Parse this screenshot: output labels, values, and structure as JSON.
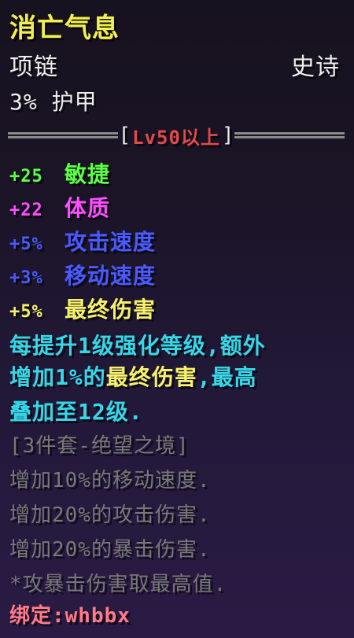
{
  "item": {
    "name": "消亡气息",
    "slot": "项链",
    "rarity": "史诗",
    "armor": "3% 护甲"
  },
  "requirement": {
    "label": "Lv50以上",
    "left_bracket": "[",
    "right_bracket": "]"
  },
  "stats": [
    {
      "value": "+25",
      "name": "敏捷"
    },
    {
      "value": "+22",
      "name": "体质"
    },
    {
      "value": "+5%",
      "name": "攻击速度"
    },
    {
      "value": "+3%",
      "name": "移动速度"
    },
    {
      "value": "+5%",
      "name": "最终伤害"
    }
  ],
  "description": {
    "line1": "每提升1级强化等级,额外",
    "line2_a": "增加1%的",
    "line2_b": "最终伤害",
    "line2_c": ",最高",
    "line3": "叠加至12级."
  },
  "set_bonus": {
    "title": "[3件套-绝望之境]",
    "lines": [
      "增加10%的移动速度.",
      "增加20%的攻击伤害.",
      "增加20%的暴击伤害.",
      "*攻暴击伤害取最高值."
    ]
  },
  "binding": "绑定:whbbx",
  "colors": {
    "title": "#f2f04e",
    "agility": "#5dff45",
    "constitution": "#ff4fff",
    "speed": "#4a5aff",
    "final_damage": "#f6f26a",
    "description": "#35d8e8",
    "set_text": "#787878",
    "requirement": "#e04a4a",
    "binding": "#ff7a8a"
  }
}
